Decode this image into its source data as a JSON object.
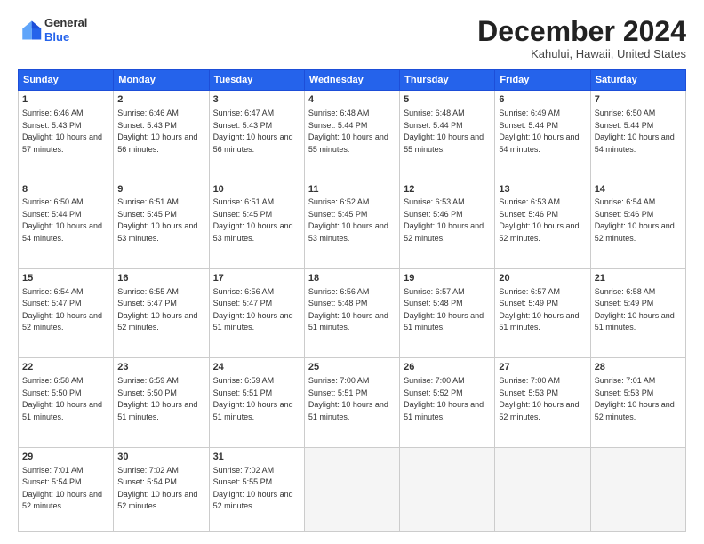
{
  "header": {
    "logo": {
      "line1": "General",
      "line2": "Blue"
    },
    "title": "December 2024",
    "location": "Kahului, Hawaii, United States"
  },
  "weekdays": [
    "Sunday",
    "Monday",
    "Tuesday",
    "Wednesday",
    "Thursday",
    "Friday",
    "Saturday"
  ],
  "weeks": [
    [
      {
        "day": "1",
        "sunrise": "6:46 AM",
        "sunset": "5:43 PM",
        "daylight": "10 hours and 57 minutes."
      },
      {
        "day": "2",
        "sunrise": "6:46 AM",
        "sunset": "5:43 PM",
        "daylight": "10 hours and 56 minutes."
      },
      {
        "day": "3",
        "sunrise": "6:47 AM",
        "sunset": "5:43 PM",
        "daylight": "10 hours and 56 minutes."
      },
      {
        "day": "4",
        "sunrise": "6:48 AM",
        "sunset": "5:44 PM",
        "daylight": "10 hours and 55 minutes."
      },
      {
        "day": "5",
        "sunrise": "6:48 AM",
        "sunset": "5:44 PM",
        "daylight": "10 hours and 55 minutes."
      },
      {
        "day": "6",
        "sunrise": "6:49 AM",
        "sunset": "5:44 PM",
        "daylight": "10 hours and 54 minutes."
      },
      {
        "day": "7",
        "sunrise": "6:50 AM",
        "sunset": "5:44 PM",
        "daylight": "10 hours and 54 minutes."
      }
    ],
    [
      {
        "day": "8",
        "sunrise": "6:50 AM",
        "sunset": "5:44 PM",
        "daylight": "10 hours and 54 minutes."
      },
      {
        "day": "9",
        "sunrise": "6:51 AM",
        "sunset": "5:45 PM",
        "daylight": "10 hours and 53 minutes."
      },
      {
        "day": "10",
        "sunrise": "6:51 AM",
        "sunset": "5:45 PM",
        "daylight": "10 hours and 53 minutes."
      },
      {
        "day": "11",
        "sunrise": "6:52 AM",
        "sunset": "5:45 PM",
        "daylight": "10 hours and 53 minutes."
      },
      {
        "day": "12",
        "sunrise": "6:53 AM",
        "sunset": "5:46 PM",
        "daylight": "10 hours and 52 minutes."
      },
      {
        "day": "13",
        "sunrise": "6:53 AM",
        "sunset": "5:46 PM",
        "daylight": "10 hours and 52 minutes."
      },
      {
        "day": "14",
        "sunrise": "6:54 AM",
        "sunset": "5:46 PM",
        "daylight": "10 hours and 52 minutes."
      }
    ],
    [
      {
        "day": "15",
        "sunrise": "6:54 AM",
        "sunset": "5:47 PM",
        "daylight": "10 hours and 52 minutes."
      },
      {
        "day": "16",
        "sunrise": "6:55 AM",
        "sunset": "5:47 PM",
        "daylight": "10 hours and 52 minutes."
      },
      {
        "day": "17",
        "sunrise": "6:56 AM",
        "sunset": "5:47 PM",
        "daylight": "10 hours and 51 minutes."
      },
      {
        "day": "18",
        "sunrise": "6:56 AM",
        "sunset": "5:48 PM",
        "daylight": "10 hours and 51 minutes."
      },
      {
        "day": "19",
        "sunrise": "6:57 AM",
        "sunset": "5:48 PM",
        "daylight": "10 hours and 51 minutes."
      },
      {
        "day": "20",
        "sunrise": "6:57 AM",
        "sunset": "5:49 PM",
        "daylight": "10 hours and 51 minutes."
      },
      {
        "day": "21",
        "sunrise": "6:58 AM",
        "sunset": "5:49 PM",
        "daylight": "10 hours and 51 minutes."
      }
    ],
    [
      {
        "day": "22",
        "sunrise": "6:58 AM",
        "sunset": "5:50 PM",
        "daylight": "10 hours and 51 minutes."
      },
      {
        "day": "23",
        "sunrise": "6:59 AM",
        "sunset": "5:50 PM",
        "daylight": "10 hours and 51 minutes."
      },
      {
        "day": "24",
        "sunrise": "6:59 AM",
        "sunset": "5:51 PM",
        "daylight": "10 hours and 51 minutes."
      },
      {
        "day": "25",
        "sunrise": "7:00 AM",
        "sunset": "5:51 PM",
        "daylight": "10 hours and 51 minutes."
      },
      {
        "day": "26",
        "sunrise": "7:00 AM",
        "sunset": "5:52 PM",
        "daylight": "10 hours and 51 minutes."
      },
      {
        "day": "27",
        "sunrise": "7:00 AM",
        "sunset": "5:53 PM",
        "daylight": "10 hours and 52 minutes."
      },
      {
        "day": "28",
        "sunrise": "7:01 AM",
        "sunset": "5:53 PM",
        "daylight": "10 hours and 52 minutes."
      }
    ],
    [
      {
        "day": "29",
        "sunrise": "7:01 AM",
        "sunset": "5:54 PM",
        "daylight": "10 hours and 52 minutes."
      },
      {
        "day": "30",
        "sunrise": "7:02 AM",
        "sunset": "5:54 PM",
        "daylight": "10 hours and 52 minutes."
      },
      {
        "day": "31",
        "sunrise": "7:02 AM",
        "sunset": "5:55 PM",
        "daylight": "10 hours and 52 minutes."
      },
      null,
      null,
      null,
      null
    ]
  ]
}
